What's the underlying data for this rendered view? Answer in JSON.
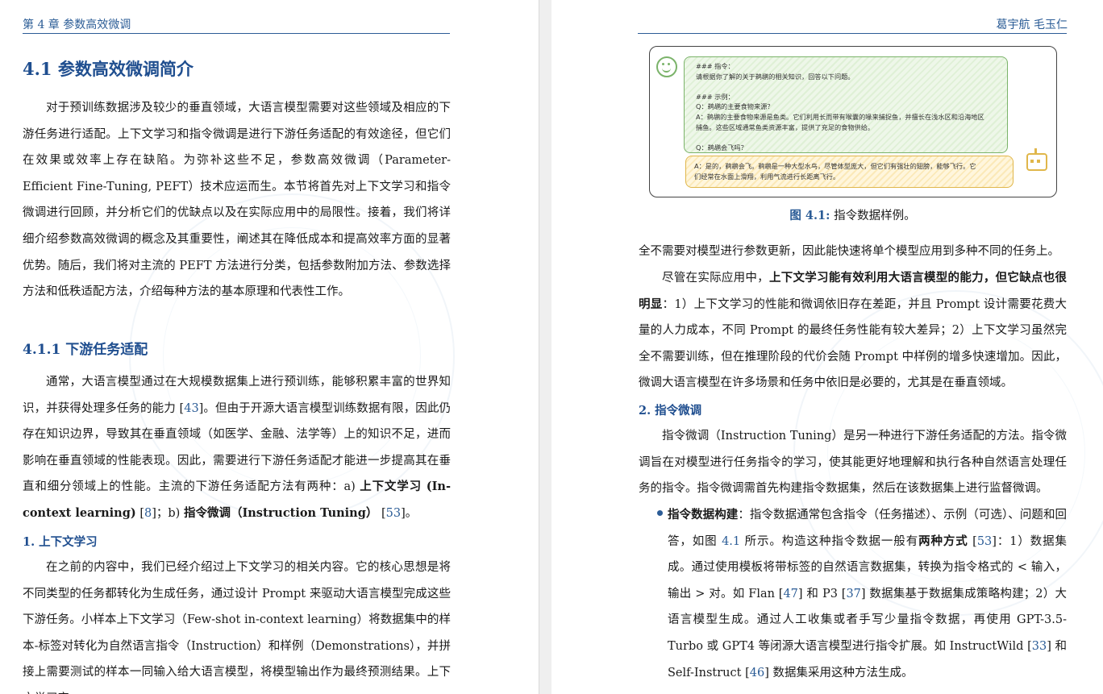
{
  "left_page": {
    "running_head": "第 4 章  参数高效微调",
    "section_title": "4.1   参数高效微调简介",
    "intro_paragraph": "对于预训练数据涉及较少的垂直领域，大语言模型需要对这些领域及相应的下游任务进行适配。上下文学习和指令微调是进行下游任务适配的有效途径，但它们在效果或效率上存在缺陷。为弥补这些不足，参数高效微调（Parameter-Efficient Fine-Tuning, PEFT）技术应运而生。本节将首先对上下文学习和指令微调进行回顾，并分析它们的优缺点以及在实际应用中的局限性。接着，我们将详细介绍参数高效微调的概念及其重要性，阐述其在降低成本和提高效率方面的显著优势。随后，我们将对主流的 PEFT 方法进行分类，包括参数附加方法、参数选择方法和低秩适配方法，介绍每种方法的基本原理和代表性工作。",
    "subsection_title": "4.1.1   下游任务适配",
    "para2_a": "通常，大语言模型通过在大规模数据集上进行预训练，能够积累丰富的世界知识，并获得处理多任务的能力 [",
    "para2_cite1": "43",
    "para2_b": "]。但由于开源大语言模型训练数据有限，因此仍存在知识边界，导致其在垂直领域（如医学、金融、法学等）上的知识不足，进而影响在垂直领域的性能表现。因此，需要进行下游任务适配才能进一步提高其在垂直和细分领域上的性能。主流的下游任务适配方法有两种：a) ",
    "para2_bold1": "上下文学习 (In-context learning)",
    "para2_c": " [",
    "para2_cite2": "8",
    "para2_d": "]；b) ",
    "para2_bold2": "指令微调（Instruction Tuning）",
    "para2_e": " [",
    "para2_cite3": "53",
    "para2_f": "]。",
    "para_title_1": "1. 上下文学习",
    "para3": "在之前的内容中，我们已经介绍过上下文学习的相关内容。它的核心思想是将不同类型的任务都转化为生成任务，通过设计 Prompt 来驱动大语言模型完成这些下游任务。小样本上下文学习（Few-shot in-context learning）将数据集中的样本-标签对转化为自然语言指令（Instruction）和样例（Demonstrations），并拼接上需要测试的样本一同输入给大语言模型，将模型输出作为最终预测结果。上下文学习完"
  },
  "right_page": {
    "running_head": "葛宇航  毛玉仁",
    "figure": {
      "q_lines": [
        "### 指令：",
        "请根据你了解的关于鹈鹕的相关知识，回答以下问题。",
        "",
        "### 示例：",
        "Q：鹈鹕的主要食物来源？",
        "A：鹈鹕的主要食物来源是鱼类。它们利用长而带有喉囊的喙来捕捉鱼，并擅长在浅水区和沿海地区",
        "捕鱼。这些区域通常鱼类资源丰富，提供了充足的食物供给。",
        "",
        "Q：鹈鹕会飞吗？"
      ],
      "a_lines": [
        "A：是的，鹈鹕会飞。鹈鹕是一种大型水鸟，尽管体型庞大，但它们有强壮的翅膀，能够飞行。它",
        "们经常在水面上滑翔，利用气流进行长距离飞行。"
      ],
      "user_icon": "smiley-face-icon",
      "bot_icon": "robot-icon"
    },
    "caption_label": "图 4.1:",
    "caption_text": " 指令数据样例。",
    "para1": "全不需要对模型进行参数更新，因此能快速将单个模型应用到多种不同的任务上。",
    "para2_a": "尽管在实际应用中，",
    "para2_bold": "上下文学习能有效利用大语言模型的能力，但它缺点也很明显",
    "para2_b": "：1）上下文学习的性能和微调依旧存在差距，并且 Prompt 设计需要花费大量的人力成本，不同 Prompt 的最终任务性能有较大差异；2）上下文学习虽然完全不需要训练，但在推理阶段的代价会随 Prompt 中样例的增多快速增加。因此，微调大语言模型在许多场景和任务中依旧是必要的，尤其是在垂直领域。",
    "para_title_2": "2. 指令微调",
    "para3": "指令微调（Instruction Tuning）是另一种进行下游任务适配的方法。指令微调旨在对模型进行任务指令的学习，使其能更好地理解和执行各种自然语言处理任务的指令。指令微调需首先构建指令数据集，然后在该数据集上进行监督微调。",
    "bullet_bold": "指令数据构建",
    "bullet_a": "：指令数据通常包含指令（任务描述）、示例（可选）、问题和回答，如图 ",
    "bullet_ref": "4.1",
    "bullet_b": " 所示。构造这种指令数据一般有",
    "bullet_bold2": "两种方式",
    "bullet_c": " [",
    "bullet_cite1": "53",
    "bullet_d": "]：1）数据集成。通过使用模板将带标签的自然语言数据集，转换为指令格式的 < 输入，输出 > 对。如 Flan [",
    "bullet_cite2": "47",
    "bullet_e": "] 和 P3 [",
    "bullet_cite3": "37",
    "bullet_f": "] 数据集基于数据集成策略构建；2）大语言模型生成。通过人工收集或者手写少量指令数据，再使用 GPT-3.5-Turbo 或 GPT4 等闭源大语言模型进行指令扩展。如 InstructWild [",
    "bullet_cite4": "33",
    "bullet_g": "] 和 Self-Instruct [",
    "bullet_cite5": "46",
    "bullet_h": "] 数据集采用这种方法生成。"
  }
}
